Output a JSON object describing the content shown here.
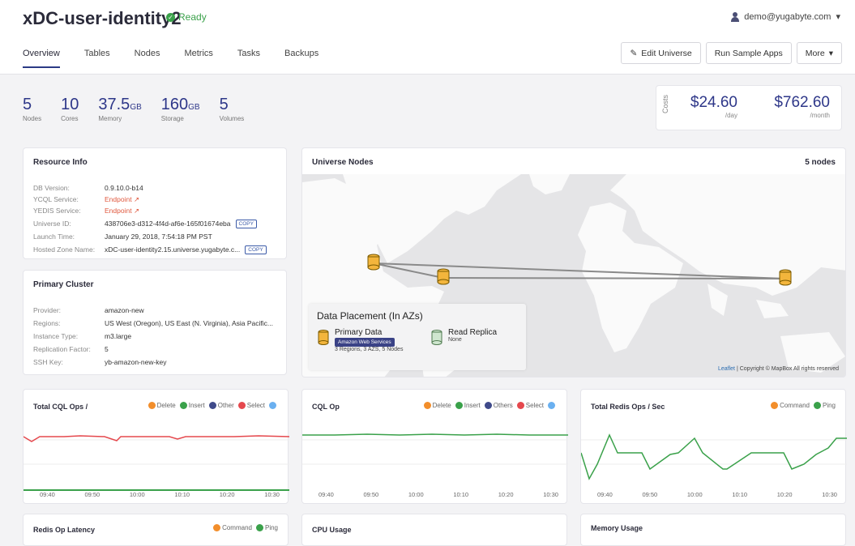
{
  "header": {
    "title": "xDC-user-identity2",
    "status": "Ready",
    "user": "demo@yugabyte.com",
    "tabs": [
      "Overview",
      "Tables",
      "Nodes",
      "Metrics",
      "Tasks",
      "Backups"
    ],
    "actions": {
      "edit": "Edit Universe",
      "sample": "Run Sample Apps",
      "more": "More"
    }
  },
  "stats": [
    {
      "value": "5",
      "unit": "",
      "label": "Nodes"
    },
    {
      "value": "10",
      "unit": "",
      "label": "Cores"
    },
    {
      "value": "37.5",
      "unit": "GB",
      "label": "Memory"
    },
    {
      "value": "160",
      "unit": "GB",
      "label": "Storage"
    },
    {
      "value": "5",
      "unit": "",
      "label": "Volumes"
    }
  ],
  "costs": {
    "label": "Costs",
    "day_value": "$24.60",
    "day_label": "/day",
    "month_value": "$762.60",
    "month_label": "/month"
  },
  "resource_info": {
    "title": "Resource Info",
    "rows": [
      {
        "k": "DB Version:",
        "v": "0.9.10.0-b14"
      },
      {
        "k": "YCQL Service:",
        "v": "Endpoint"
      },
      {
        "k": "YEDIS Service:",
        "v": "Endpoint"
      },
      {
        "k": "Universe ID:",
        "v": "438706e3-d312-4f4d-af6e-165f01674eba"
      },
      {
        "k": "Launch Time:",
        "v": "January 29, 2018, 7:54:18 PM PST"
      },
      {
        "k": "Hosted Zone Name:",
        "v": "xDC-user-identity2.15.universe.yugabyte.c..."
      }
    ],
    "copy": "COPY"
  },
  "primary_cluster": {
    "title": "Primary Cluster",
    "rows": [
      {
        "k": "Provider:",
        "v": "amazon-new"
      },
      {
        "k": "Regions:",
        "v": "US West (Oregon), US East (N. Virginia), Asia Pacific..."
      },
      {
        "k": "Instance Type:",
        "v": "m3.large"
      },
      {
        "k": "Replication Factor:",
        "v": "5"
      },
      {
        "k": "SSH Key:",
        "v": "yb-amazon-new-key"
      }
    ]
  },
  "universe_nodes": {
    "title": "Universe Nodes",
    "count": "5 nodes",
    "placement_title": "Data Placement (In AZs)",
    "primary_label": "Primary Data",
    "provider_badge": "Amazon Web Services",
    "primary_summary": "3 Regions, 3 AZS, 5 Nodes",
    "replica_label": "Read Replica",
    "replica_value": "None",
    "attribution_link": "Leaflet",
    "attribution_text": " | Copyright © MapBox All rights reserved"
  },
  "charts": [
    {
      "title": "Total CQL Ops /",
      "legend": [
        "Delete",
        "Insert",
        "Other",
        "Select"
      ],
      "colors": [
        "#f28e2b",
        "#3aa14a",
        "#3f4a8a",
        "#e5484d",
        "#6ab0f0"
      ],
      "ticks": [
        "09:40",
        "09:50",
        "10:00",
        "10:10",
        "10:20",
        "10:30"
      ]
    },
    {
      "title": "CQL Op",
      "legend": [
        "Delete",
        "Insert",
        "Others",
        "Select"
      ],
      "colors": [
        "#f28e2b",
        "#3aa14a",
        "#3f4a8a",
        "#e5484d",
        "#6ab0f0"
      ],
      "ticks": [
        "09:40",
        "09:50",
        "10:00",
        "10:10",
        "10:20",
        "10:30"
      ]
    },
    {
      "title": "Total Redis Ops / Sec",
      "legend": [
        "Command",
        "Ping"
      ],
      "colors": [
        "#f28e2b",
        "#3aa14a"
      ],
      "ticks": [
        "09:40",
        "09:50",
        "10:00",
        "10:10",
        "10:20",
        "10:30"
      ]
    }
  ],
  "bottom_panels": {
    "latency": "Redis Op Latency",
    "latency_legend": [
      "Command",
      "Ping"
    ],
    "cpu": "CPU Usage",
    "memory": "Memory Usage"
  }
}
